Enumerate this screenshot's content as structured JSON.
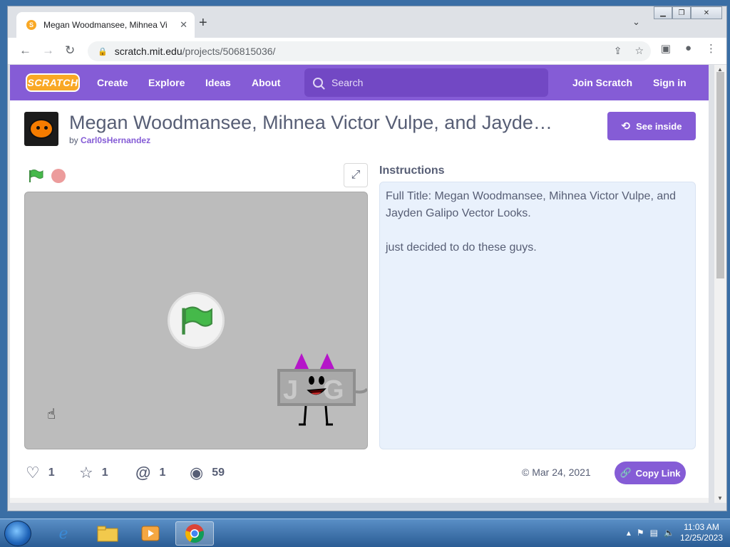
{
  "browser": {
    "tab_title": "Megan Woodmansee, Mihnea Vi",
    "tab_close": "✕",
    "new_tab": "+",
    "tab_search": "⌄",
    "url_host": "scratch.mit.edu",
    "url_path": "/projects/506815036/"
  },
  "scratch_nav": {
    "logo": "SCRATCH",
    "links": [
      "Create",
      "Explore",
      "Ideas",
      "About"
    ],
    "search_placeholder": "Search",
    "join": "Join Scratch",
    "sign_in": "Sign in"
  },
  "project": {
    "title": "Megan Woodmansee, Mihnea Victor Vulpe, and Jayde…",
    "by_prefix": "by",
    "author": "Carl0sHernandez",
    "see_inside": "See inside",
    "instructions_label": "Instructions",
    "instructions": [
      "Full Title: Megan Woodmansee, Mihnea Victor Vulpe, and Jayden Galipo Vector Looks.",
      "just decided to do these guys."
    ],
    "stats": {
      "loves": "1",
      "favorites": "1",
      "remixes": "1",
      "views": "59"
    },
    "date": "Mar 24, 2021",
    "copy_link": "Copy Link"
  },
  "taskbar": {
    "time": "11:03 AM",
    "date": "12/25/2023"
  },
  "colors": {
    "scratch_purple": "#855cd6",
    "text": "#575e75",
    "instructions_bg": "#e9f1fc",
    "green_flag": "#45b94a",
    "stop": "#ec9c9c"
  },
  "icons": [
    "back-icon",
    "forward-icon",
    "reload-icon",
    "lock-icon",
    "share-icon",
    "star-icon",
    "sidebar-icon",
    "profile-icon",
    "menu-icon",
    "search-icon",
    "see-inside-icon",
    "green-flag-icon",
    "stop-icon",
    "fullscreen-icon",
    "heart-icon",
    "star-icon",
    "remix-icon",
    "eye-icon",
    "copy-link-icon"
  ]
}
